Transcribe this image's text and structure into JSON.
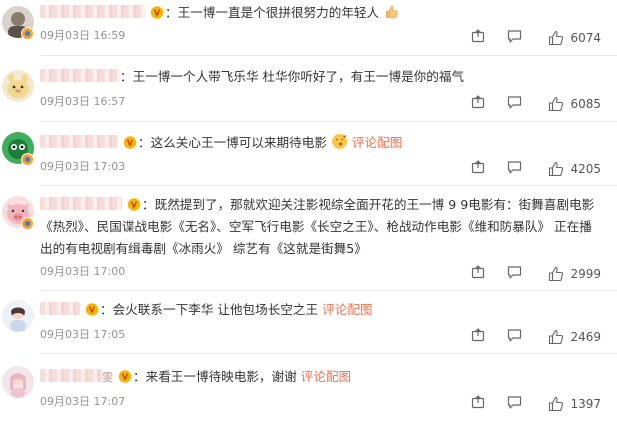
{
  "comments": [
    {
      "nick_tail": "",
      "text": "：王一博一直是个很拼很努力的年轻人",
      "has_emoji": "thumbs-up",
      "link": "",
      "time": "09月03日 16:59",
      "likes": "6074"
    },
    {
      "nick_tail": "",
      "text": "：王一博一个人带飞乐华 杜华你听好了，有王一博是你的福气",
      "link": "",
      "time": "09月03日 16:57",
      "likes": "6085"
    },
    {
      "nick_tail": "",
      "text": "：这么关心王一博可以来期待电影",
      "link": "评论配图",
      "time": "09月03日 17:03",
      "likes": "4205"
    },
    {
      "nick_tail": "",
      "lines": [
        "：既然提到了，那就欢迎关注影视综全面开花的王一博 9 9电影有：街舞喜剧电影",
        "《热烈》、民国谍战电影《无名》、空军飞行电影《长空之王》、枪战动作电影《维和防暴队》 正在播",
        "出的有电视剧有缉毒剧《冰雨火》 综艺有《这就是街舞5》"
      ],
      "time": "09月03日 17:00",
      "likes": "2999"
    },
    {
      "nick_tail": "",
      "text": "：会火联系一下李华 让他包场长空之王",
      "link": "评论配图",
      "time": "09月03日 17:05",
      "likes": "2469"
    },
    {
      "nick_tail": "雯",
      "text": "：来看王一博待映电影，谢谢",
      "link": "评论配图",
      "time": "09月03日 17:07",
      "likes": "1397"
    }
  ],
  "colors": {
    "link": "#eb7350",
    "meta": "#939393",
    "text": "#333333"
  },
  "icons": [
    "share-icon",
    "comment-icon",
    "like-icon",
    "vip-badge-icon",
    "verified-badge-icon"
  ]
}
